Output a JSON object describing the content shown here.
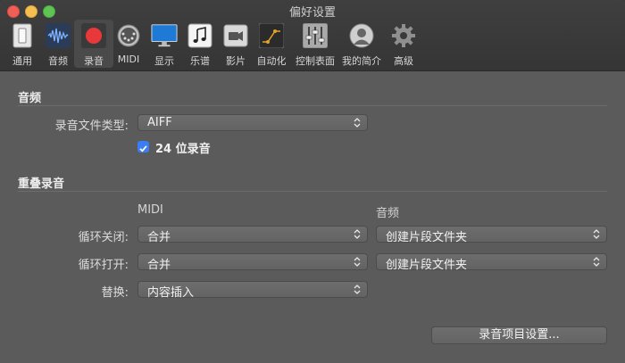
{
  "window": {
    "title": "偏好设置"
  },
  "toolbar": {
    "items": [
      {
        "label": "通用",
        "icon": "switch-icon"
      },
      {
        "label": "音频",
        "icon": "waveform-icon"
      },
      {
        "label": "录音",
        "icon": "record-icon",
        "selected": true
      },
      {
        "label": "MIDI",
        "icon": "midi-connector-icon"
      },
      {
        "label": "显示",
        "icon": "monitor-icon"
      },
      {
        "label": "乐谱",
        "icon": "music-notes-icon"
      },
      {
        "label": "影片",
        "icon": "video-camera-icon"
      },
      {
        "label": "自动化",
        "icon": "automation-curve-icon"
      },
      {
        "label": "控制表面",
        "icon": "faders-icon"
      },
      {
        "label": "我的简介",
        "icon": "person-icon"
      },
      {
        "label": "高级",
        "icon": "gear-icon"
      }
    ]
  },
  "audio_section": {
    "title": "音频",
    "file_type_label": "录音文件类型:",
    "file_type_value": "AIFF",
    "bit24_label": "24 位录音",
    "bit24_checked": true
  },
  "overlap_section": {
    "title": "重叠录音",
    "col_midi": "MIDI",
    "col_audio": "音频",
    "loop_off_label": "循环关闭:",
    "loop_off_midi": "合并",
    "loop_off_audio": "创建片段文件夹",
    "loop_on_label": "循环打开:",
    "loop_on_midi": "合并",
    "loop_on_audio": "创建片段文件夹",
    "replace_label": "替换:",
    "replace_value": "内容插入"
  },
  "footer": {
    "project_settings_button": "录音项目设置..."
  },
  "colors": {
    "accent": "#3b7df2",
    "record_red": "#e8383a",
    "background": "#5b5b5b"
  }
}
